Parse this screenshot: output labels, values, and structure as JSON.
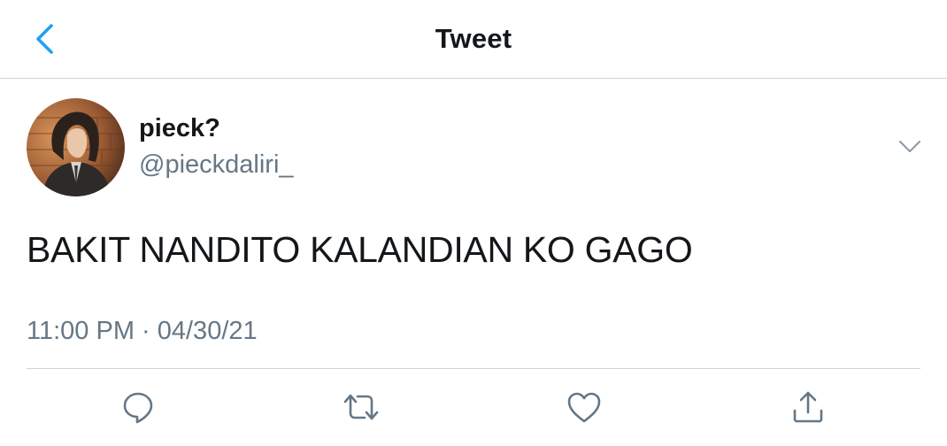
{
  "header": {
    "title": "Tweet",
    "back_icon": "chevron-left-icon"
  },
  "tweet": {
    "author": {
      "display_name": "pieck?",
      "handle": "@pieckdaliri_",
      "avatar": "avatar-image"
    },
    "text": "BAKIT NANDITO KALANDIAN KO GAGO",
    "timestamp": "11:00 PM · 04/30/21"
  },
  "actions": {
    "reply_icon": "speech-bubble-icon",
    "retweet_icon": "retweet-icon",
    "like_icon": "heart-icon",
    "share_icon": "share-upload-icon"
  },
  "colors": {
    "accent": "#1da1f2",
    "text_primary": "#14171a",
    "text_secondary": "#657786",
    "divider": "#cfd4d8"
  }
}
